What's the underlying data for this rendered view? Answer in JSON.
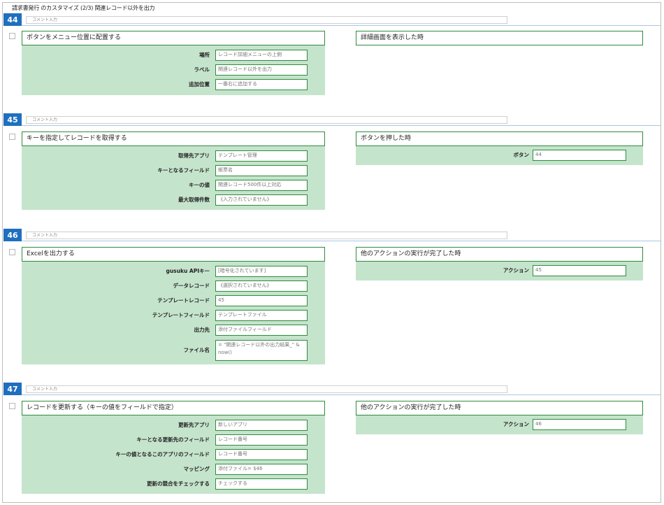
{
  "page_title": "請求書発行 のカスタマイズ (2/3) 関連レコード以外を出力",
  "comment_placeholder": "コメント入力",
  "steps": [
    {
      "number": "44",
      "action_title": "ボタンをメニュー位置に配置する",
      "fields": [
        {
          "label": "場所",
          "value": "レコード詳細メニューの上側"
        },
        {
          "label": "ラベル",
          "value": "関連レコード以外を出力"
        },
        {
          "label": "追加位置",
          "value": "一番右に追加する"
        }
      ],
      "trigger_title": "詳細画面を表示した時"
    },
    {
      "number": "45",
      "action_title": "キーを指定してレコードを取得する",
      "fields": [
        {
          "label": "取得先アプリ",
          "value": "テンプレート管理"
        },
        {
          "label": "キーとなるフィールド",
          "value": "帳票名"
        },
        {
          "label": "キーの値",
          "value": "関連レコード500件以上対応"
        },
        {
          "label": "最大取得件数",
          "value": "《入力されていません》"
        }
      ],
      "trigger_title": "ボタンを押した時",
      "trigger_label": "ボタン",
      "trigger_value": "44"
    },
    {
      "number": "46",
      "action_title": "Excelを出力する",
      "fields": [
        {
          "label": "gusuku APIキー",
          "value": "[暗号化されています]"
        },
        {
          "label": "データレコード",
          "value": "《選択されていません》"
        },
        {
          "label": "テンプレートレコード",
          "value": "45"
        },
        {
          "label": "テンプレートフィールド",
          "value": "テンプレートファイル"
        },
        {
          "label": "出力先",
          "value": "添付ファイルフィールド"
        },
        {
          "label": "ファイル名",
          "value": "= \"関連レコード以外の出力結果_\" & now()"
        }
      ],
      "trigger_title": "他のアクションの実行が完了した時",
      "trigger_label": "アクション",
      "trigger_value": "45"
    },
    {
      "number": "47",
      "action_title": "レコードを更新する（キーの値をフィールドで指定）",
      "fields": [
        {
          "label": "更新先アプリ",
          "value": "新しいアプリ"
        },
        {
          "label": "キーとなる更新先のフィールド",
          "value": "レコード番号"
        },
        {
          "label": "キーの値となるこのアプリのフィールド",
          "value": "レコード番号"
        },
        {
          "label": "マッピング",
          "value": "添付ファイル= $46"
        },
        {
          "label": "更新の競合をチェックする",
          "value": "チェックする"
        }
      ],
      "trigger_title": "他のアクションの実行が完了した時",
      "trigger_label": "アクション",
      "trigger_value": "46"
    }
  ]
}
